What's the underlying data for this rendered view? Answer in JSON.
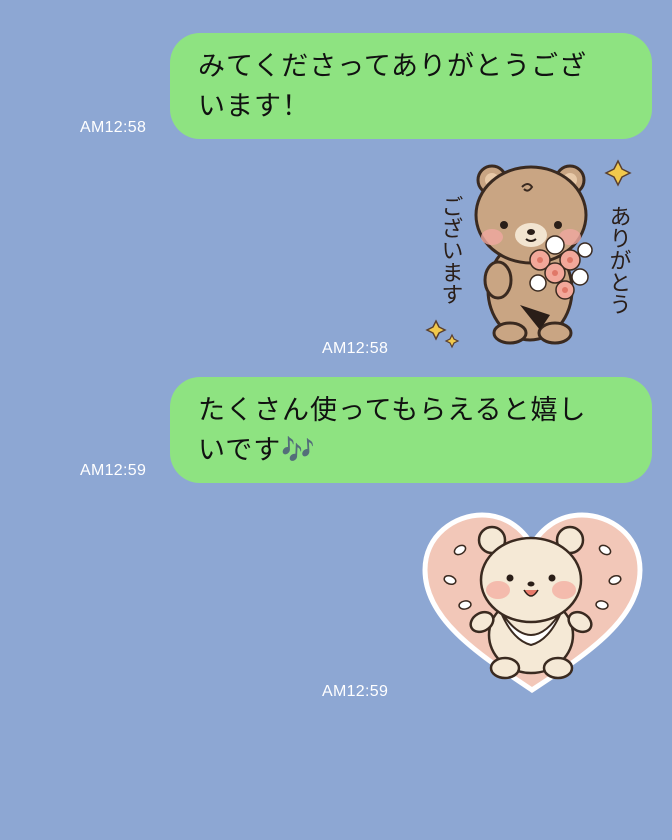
{
  "colors": {
    "background": "#8da7d3",
    "bubble": "#8ee381",
    "timestamp": "#ffffff"
  },
  "messages": [
    {
      "type": "text",
      "lines": [
        "みてくださってありがとうござ",
        "います！"
      ],
      "time": "AM12:58"
    },
    {
      "type": "sticker",
      "sticker_text": [
        "ありがとう",
        "ございます"
      ],
      "icon": "bear-bouquet-sticker",
      "time": "AM12:58"
    },
    {
      "type": "text",
      "lines": [
        "たくさん使ってもらえると嬉し",
        "いです🎶"
      ],
      "time": "AM12:59"
    },
    {
      "type": "sticker",
      "icon": "bear-heart-sticker",
      "time": "AM12:59"
    }
  ]
}
